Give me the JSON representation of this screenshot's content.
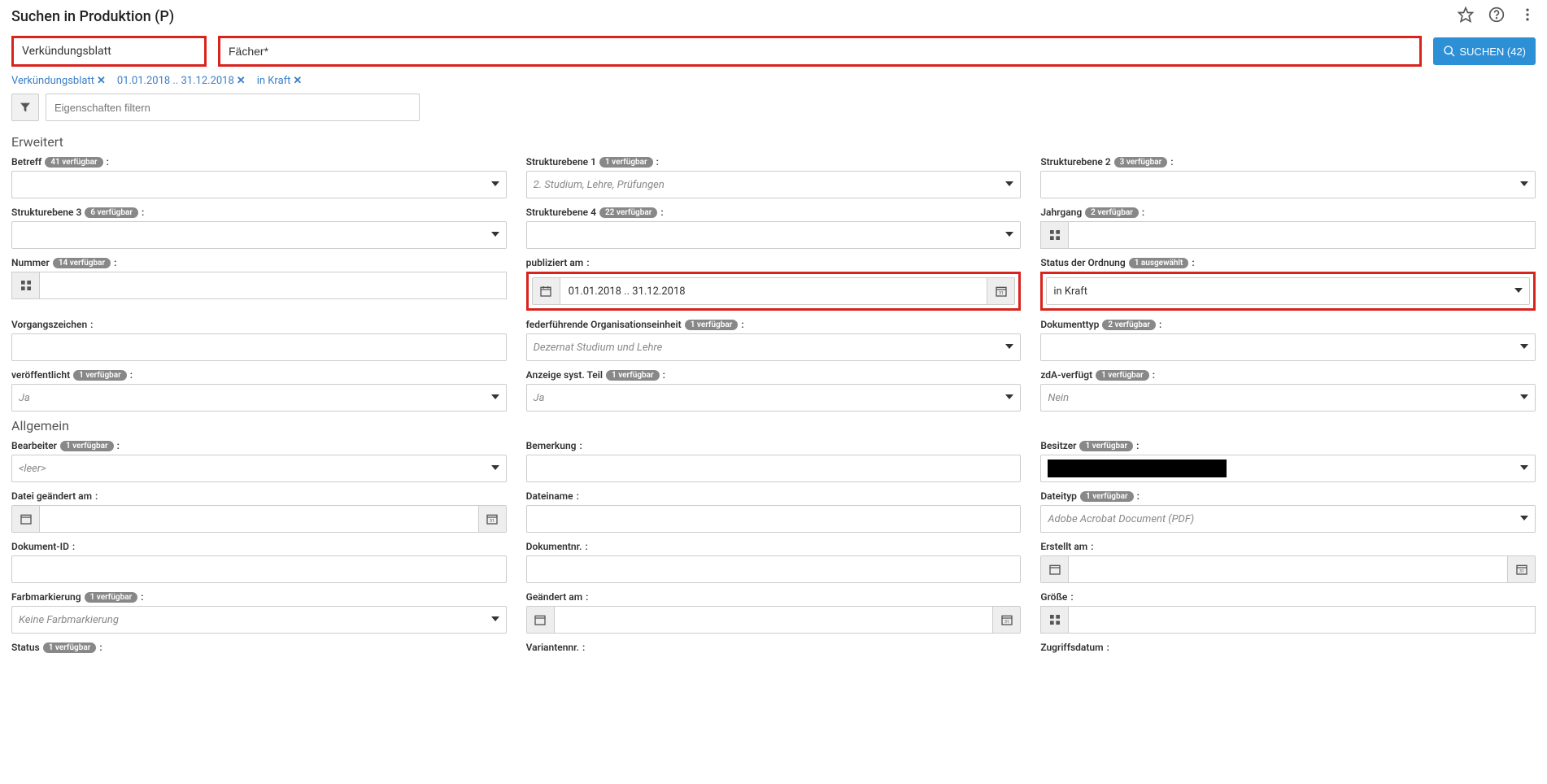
{
  "header": {
    "title": "Suchen in Produktion (P)"
  },
  "searchbar": {
    "type_value": "Verkündungsblatt",
    "query": "Fächer*",
    "button_label": "SUCHEN (42)"
  },
  "chips": [
    {
      "label": "Verkündungsblatt"
    },
    {
      "label": "01.01.2018 .. 31.12.2018"
    },
    {
      "label": "in Kraft"
    }
  ],
  "filter": {
    "placeholder": "Eigenschaften filtern"
  },
  "sections": {
    "erweitert": {
      "title": "Erweitert",
      "fields": {
        "betreff": {
          "label": "Betreff",
          "badge": "41 verfügbar"
        },
        "se1": {
          "label": "Strukturebene 1",
          "badge": "1 verfügbar",
          "value": "2. Studium, Lehre, Prüfungen"
        },
        "se2": {
          "label": "Strukturebene 2",
          "badge": "3 verfügbar"
        },
        "se3": {
          "label": "Strukturebene 3",
          "badge": "6 verfügbar"
        },
        "se4": {
          "label": "Strukturebene 4",
          "badge": "22 verfügbar"
        },
        "jahrgang": {
          "label": "Jahrgang",
          "badge": "2 verfügbar"
        },
        "nummer": {
          "label": "Nummer",
          "badge": "14 verfügbar"
        },
        "publiziert": {
          "label": "publiziert am",
          "value": "01.01.2018 .. 31.12.2018"
        },
        "status": {
          "label": "Status der Ordnung",
          "badge": "1 ausgewählt",
          "value": "in Kraft"
        },
        "vorgang": {
          "label": "Vorgangszeichen"
        },
        "feder": {
          "label": "federführende Organisationseinheit",
          "badge": "1 verfügbar",
          "value": "Dezernat Studium und Lehre"
        },
        "doktyp": {
          "label": "Dokumenttyp",
          "badge": "2 verfügbar"
        },
        "veroeff": {
          "label": "veröffentlicht",
          "badge": "1 verfügbar",
          "value": "Ja"
        },
        "anzeige": {
          "label": "Anzeige syst. Teil",
          "badge": "1 verfügbar",
          "value": "Ja"
        },
        "zda": {
          "label": "zdA-verfügt",
          "badge": "1 verfügbar",
          "value": "Nein"
        }
      }
    },
    "allgemein": {
      "title": "Allgemein",
      "fields": {
        "bearbeiter": {
          "label": "Bearbeiter",
          "badge": "1 verfügbar",
          "value": "<leer>"
        },
        "bemerkung": {
          "label": "Bemerkung"
        },
        "besitzer": {
          "label": "Besitzer",
          "badge": "1 verfügbar"
        },
        "dateigeaendert": {
          "label": "Datei geändert am"
        },
        "dateiname": {
          "label": "Dateiname"
        },
        "dateityp": {
          "label": "Dateityp",
          "badge": "1 verfügbar",
          "value": "Adobe Acrobat Document (PDF)"
        },
        "dokid": {
          "label": "Dokument-ID"
        },
        "doknr": {
          "label": "Dokumentnr."
        },
        "erstellt": {
          "label": "Erstellt am"
        },
        "farbe": {
          "label": "Farbmarkierung",
          "badge": "1 verfügbar",
          "value": "Keine Farbmarkierung"
        },
        "geaendert": {
          "label": "Geändert am"
        },
        "groesse": {
          "label": "Größe"
        },
        "status2": {
          "label": "Status",
          "badge": "1 verfügbar"
        },
        "variante": {
          "label": "Variantennr."
        },
        "zugriff": {
          "label": "Zugriffsdatum"
        }
      }
    }
  }
}
